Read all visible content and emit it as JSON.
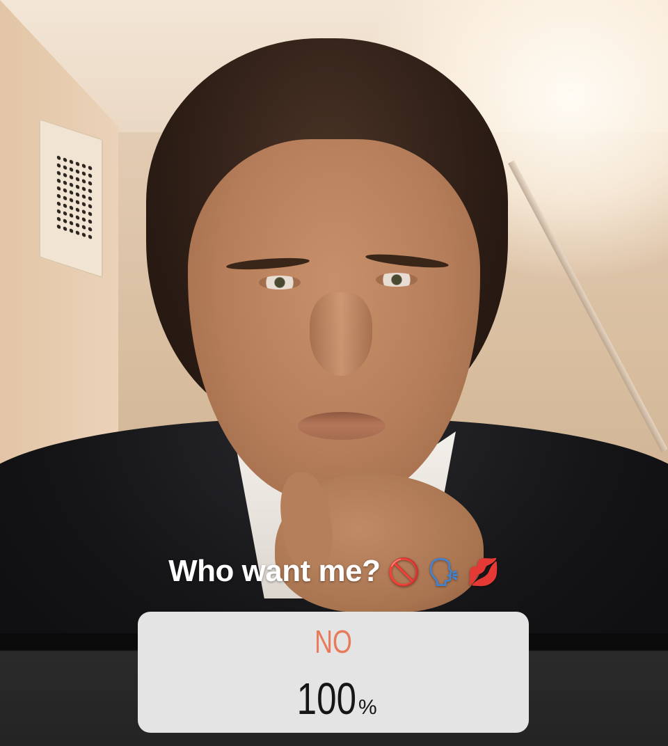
{
  "story": {
    "caption_text": "Who want me?",
    "caption_emojis": {
      "no_entry": "🚫",
      "speaking_head": "🗣",
      "kiss_mark": "💋"
    }
  },
  "poll": {
    "option_label": "NO",
    "percent_value": "100",
    "percent_sign": "%",
    "result_fraction": 1.0
  },
  "colors": {
    "poll_option_text": "#e87a5c",
    "poll_background": "#e4e4e4",
    "caption_text": "#ffffff"
  }
}
